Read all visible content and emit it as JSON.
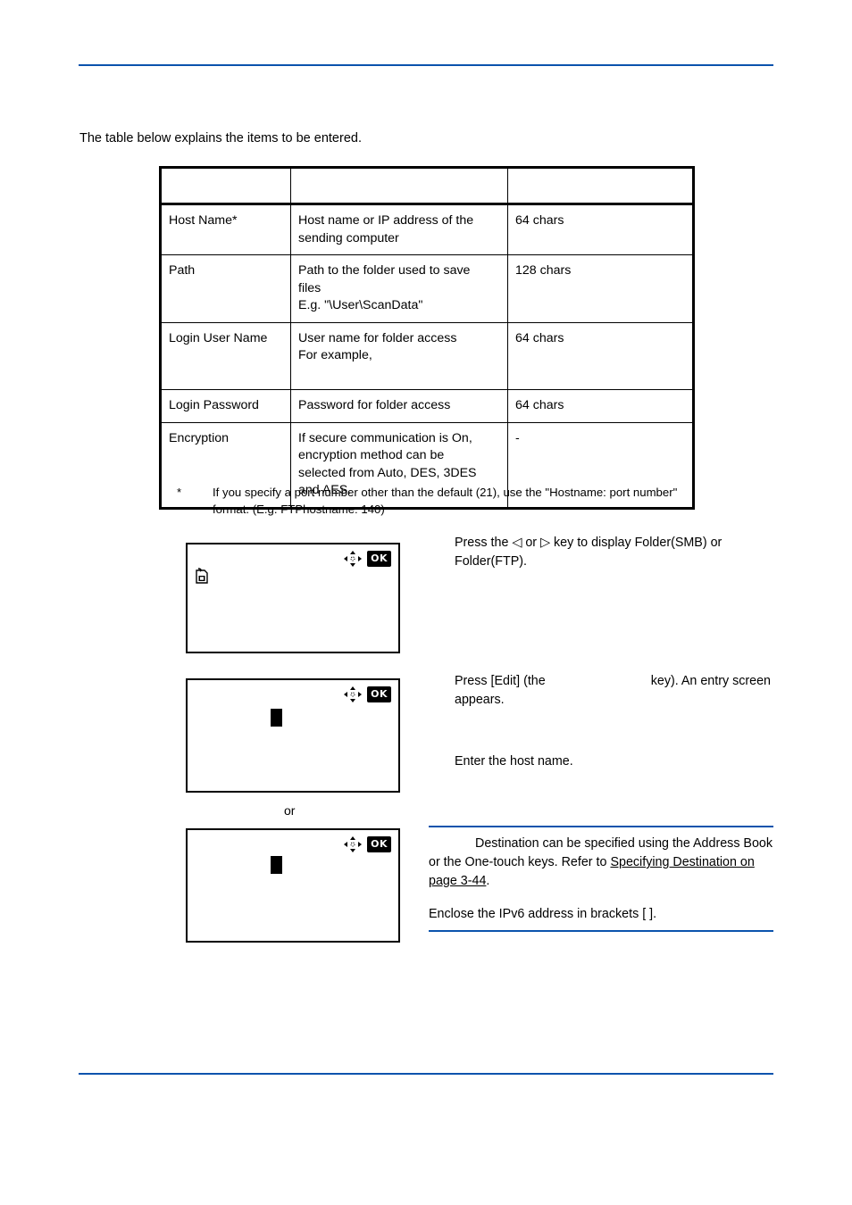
{
  "page": {
    "intro_paragraph": "The table below explains the items to be entered.",
    "or_separator": "or"
  },
  "table": {
    "headers": [
      "",
      "",
      ""
    ],
    "rows": [
      {
        "item": "Host Name*",
        "detail_lines": [
          "Host name or IP address of the",
          "sending computer"
        ],
        "limit": "64 chars"
      },
      {
        "item": "Path",
        "detail_lines": [
          "Path to the folder used to save",
          "files",
          "E.g. \"\\User\\ScanData\""
        ],
        "limit": "128 chars"
      },
      {
        "item": "Login User Name",
        "detail_lines": [
          "User name for folder access",
          "For example,"
        ],
        "limit": "64 chars"
      },
      {
        "item": "Login Password",
        "detail_lines": [
          "Password for folder access"
        ],
        "limit": "64 chars"
      },
      {
        "item": "Encryption",
        "detail_lines": [
          "If secure communication is On,",
          "encryption method can be",
          "selected from Auto, DES, 3DES",
          "and AES."
        ],
        "limit": "-"
      }
    ]
  },
  "footnote": {
    "marker": "*",
    "text": "If you specify a port number other than the default (21), use the \"Hostname: port number\" format. (E.g. FTPhostname: 140)"
  },
  "steps": [
    {
      "instruction": "Press the ◁ or ▷ key to display Folder(SMB) or Folder(FTP).",
      "screen": {
        "ok_label": "OK",
        "arrows_icon": "arrow-keys-icon",
        "content_icon": "folder-document-icon"
      }
    },
    {
      "instruction_before_gap": "Press [Edit] (the",
      "instruction_after_gap": "key). An entry screen appears.",
      "screen": {
        "ok_label": "OK",
        "arrows_icon": "arrow-keys-icon",
        "cursor": "text-cursor-block"
      }
    },
    {
      "instruction": "Enter the host name.",
      "screen": {
        "ok_label": "OK",
        "arrows_icon": "arrow-keys-icon",
        "cursor": "text-cursor-block"
      }
    }
  ],
  "note": {
    "line_1": "Destination can be specified using the",
    "line_2": "Address Book or the One-touch keys. Refer to",
    "link_text": "Specifying Destination on page 3-44",
    "link_suffix": ".",
    "second_note": "Enclose the IPv6 address in brackets [ ]."
  },
  "colors": {
    "rule_blue": "#0b53ad",
    "text_black": "#000000",
    "page_background": "#ffffff"
  }
}
